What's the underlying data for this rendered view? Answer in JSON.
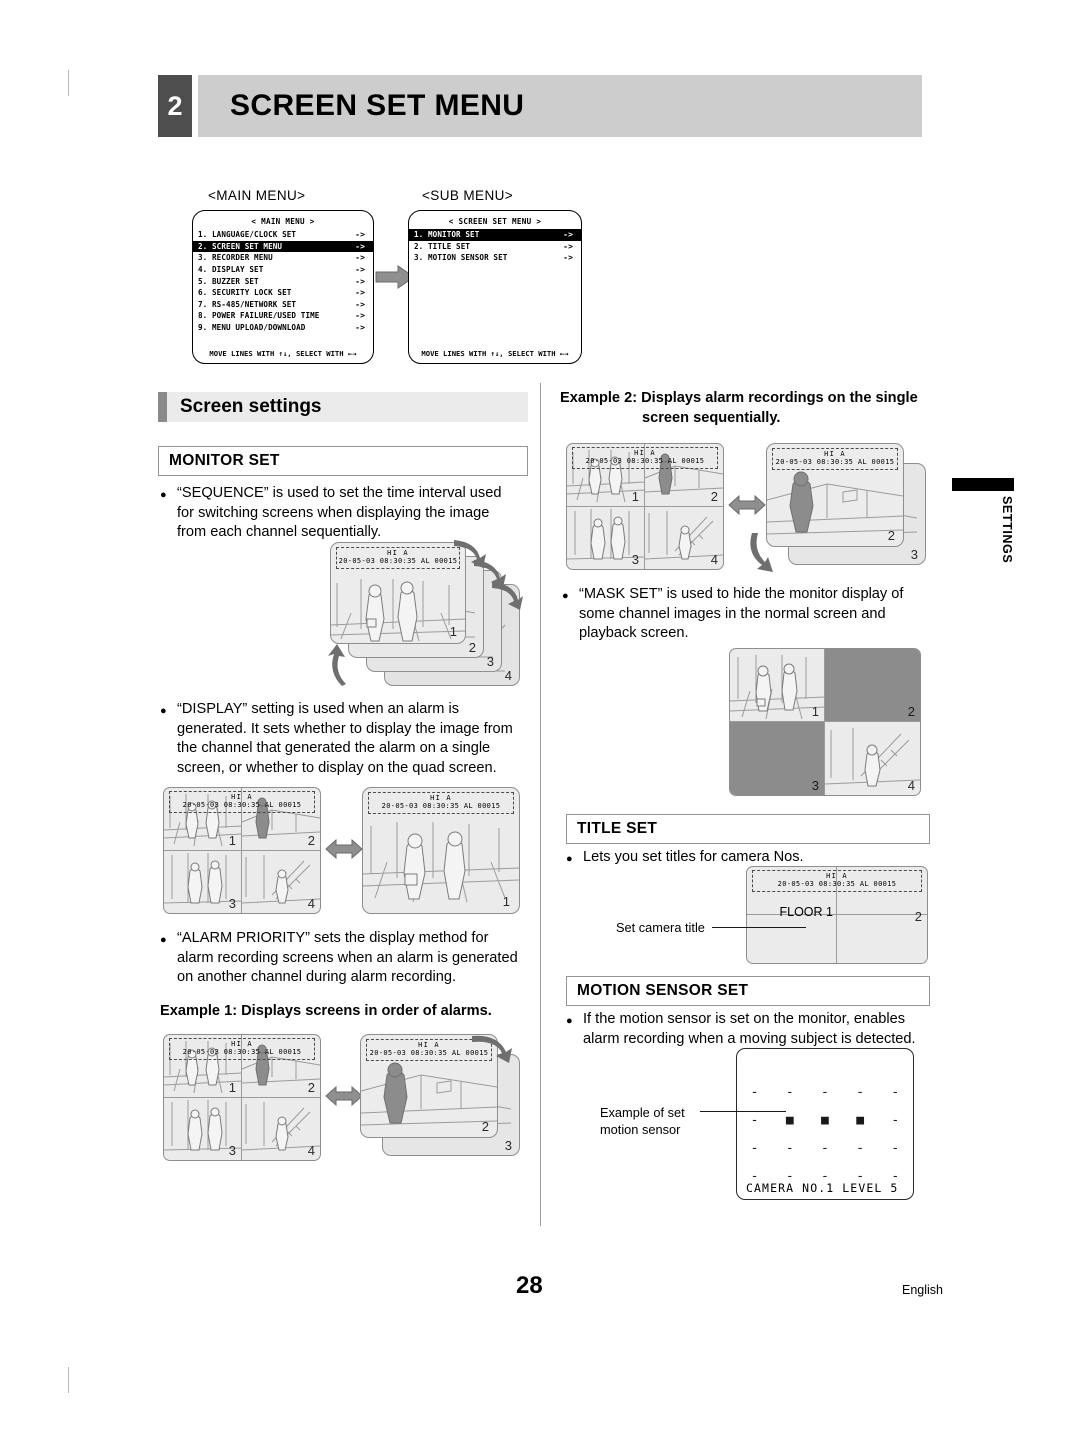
{
  "header": {
    "number": "2",
    "title": "SCREEN SET MENU"
  },
  "menu_diagram": {
    "main_caption": "<MAIN MENU>",
    "sub_caption": "<SUB MENU>",
    "main_menu": {
      "title": "< MAIN MENU >",
      "footer": "MOVE LINES WITH ↑↓, SELECT WITH ←→",
      "items": [
        {
          "label": "1. LANGUAGE/CLOCK SET",
          "arrow": "->",
          "highlighted": false
        },
        {
          "label": "2. SCREEN SET MENU",
          "arrow": "->",
          "highlighted": true
        },
        {
          "label": "3. RECORDER MENU",
          "arrow": "->",
          "highlighted": false
        },
        {
          "label": "4. DISPLAY SET",
          "arrow": "->",
          "highlighted": false
        },
        {
          "label": "5. BUZZER SET",
          "arrow": "->",
          "highlighted": false
        },
        {
          "label": "6. SECURITY LOCK SET",
          "arrow": "->",
          "highlighted": false
        },
        {
          "label": "7. RS-485/NETWORK SET",
          "arrow": "->",
          "highlighted": false
        },
        {
          "label": "8. POWER FAILURE/USED TIME",
          "arrow": "->",
          "highlighted": false
        },
        {
          "label": "9. MENU UPLOAD/DOWNLOAD",
          "arrow": "->",
          "highlighted": false
        }
      ]
    },
    "sub_menu": {
      "title": "< SCREEN SET MENU >",
      "footer": "MOVE LINES WITH ↑↓, SELECT WITH ←→",
      "items": [
        {
          "label": "1. MONITOR SET",
          "arrow": "->",
          "highlighted": true
        },
        {
          "label": "2. TITLE SET",
          "arrow": "->",
          "highlighted": false
        },
        {
          "label": "3. MOTION SENSOR SET",
          "arrow": "->",
          "highlighted": false
        }
      ]
    }
  },
  "section": {
    "title": "Screen settings"
  },
  "side_tab": {
    "label": "SETTINGS"
  },
  "osd_overlay": {
    "line1": "HI  A",
    "line2": "20-05-03 08:30:35 AL   00015"
  },
  "left_column": {
    "monitor_set_heading": "MONITOR SET",
    "sequence_text": "“SEQUENCE” is used to set the time interval used for switching screens when displaying the image from each channel sequentially.",
    "display_text": "“DISPLAY” setting is used when an alarm is generated. It sets whether to display the image from the channel that generated the alarm on a single screen, or whether to display on the quad screen.",
    "alarm_priority_text": "“ALARM PRIORITY” sets the display method for alarm recording screens when an alarm is generated on another channel during alarm recording.",
    "example1_label": "Example 1: Displays screens in order of alarms.",
    "sequence_stack_numbers": [
      "1",
      "2",
      "3",
      "4"
    ],
    "display_quad_numbers": [
      "1",
      "2",
      "3",
      "4"
    ],
    "display_single_number": "1",
    "example1_quad_numbers": [
      "1",
      "2",
      "3",
      "4"
    ],
    "example1_stack_numbers": [
      "2",
      "3"
    ]
  },
  "right_column": {
    "example2_label_lead": "Example 2:",
    "example2_label_line1": "Displays alarm recordings on the single",
    "example2_label_line2": "screen sequentially.",
    "example2_quad_numbers": [
      "1",
      "2",
      "3",
      "4"
    ],
    "example2_stack_numbers": [
      "2",
      "3"
    ],
    "mask_set_text": "“MASK SET” is used to hide the monitor display of some channel images in the normal screen and playback screen.",
    "mask_quad_numbers": [
      "1",
      "2",
      "3",
      "4"
    ],
    "mask_masked_cells": [
      2,
      3
    ],
    "title_set_heading": "TITLE SET",
    "title_set_text": "Lets you set titles for camera Nos.",
    "set_camera_title_label": "Set camera title",
    "camera_title_value": "FLOOR 1",
    "title_quad_second_number": "2",
    "motion_sensor_heading": "MOTION SENSOR SET",
    "motion_sensor_text": "If the motion sensor is set on the monitor, enables alarm recording when a moving subject is detected.",
    "motion_example_label_line1": "Example of set",
    "motion_example_label_line2": "motion sensor",
    "motion_grid": [
      [
        "-",
        "-",
        "-",
        "-",
        "-"
      ],
      [
        "-",
        "■",
        "■",
        "■",
        "-"
      ],
      [
        "-",
        "-",
        "-",
        "-",
        "-"
      ],
      [
        "-",
        "-",
        "-",
        "-",
        "-"
      ]
    ],
    "motion_caption": "CAMERA NO.1 LEVEL 5"
  },
  "footer": {
    "page_number": "28",
    "language": "English"
  },
  "colors": {
    "header_bar": "#cdcdcd",
    "header_num": "#4e4e4e",
    "section_bar": "#ebebeb",
    "mask_gray": "#8c8c8c"
  }
}
